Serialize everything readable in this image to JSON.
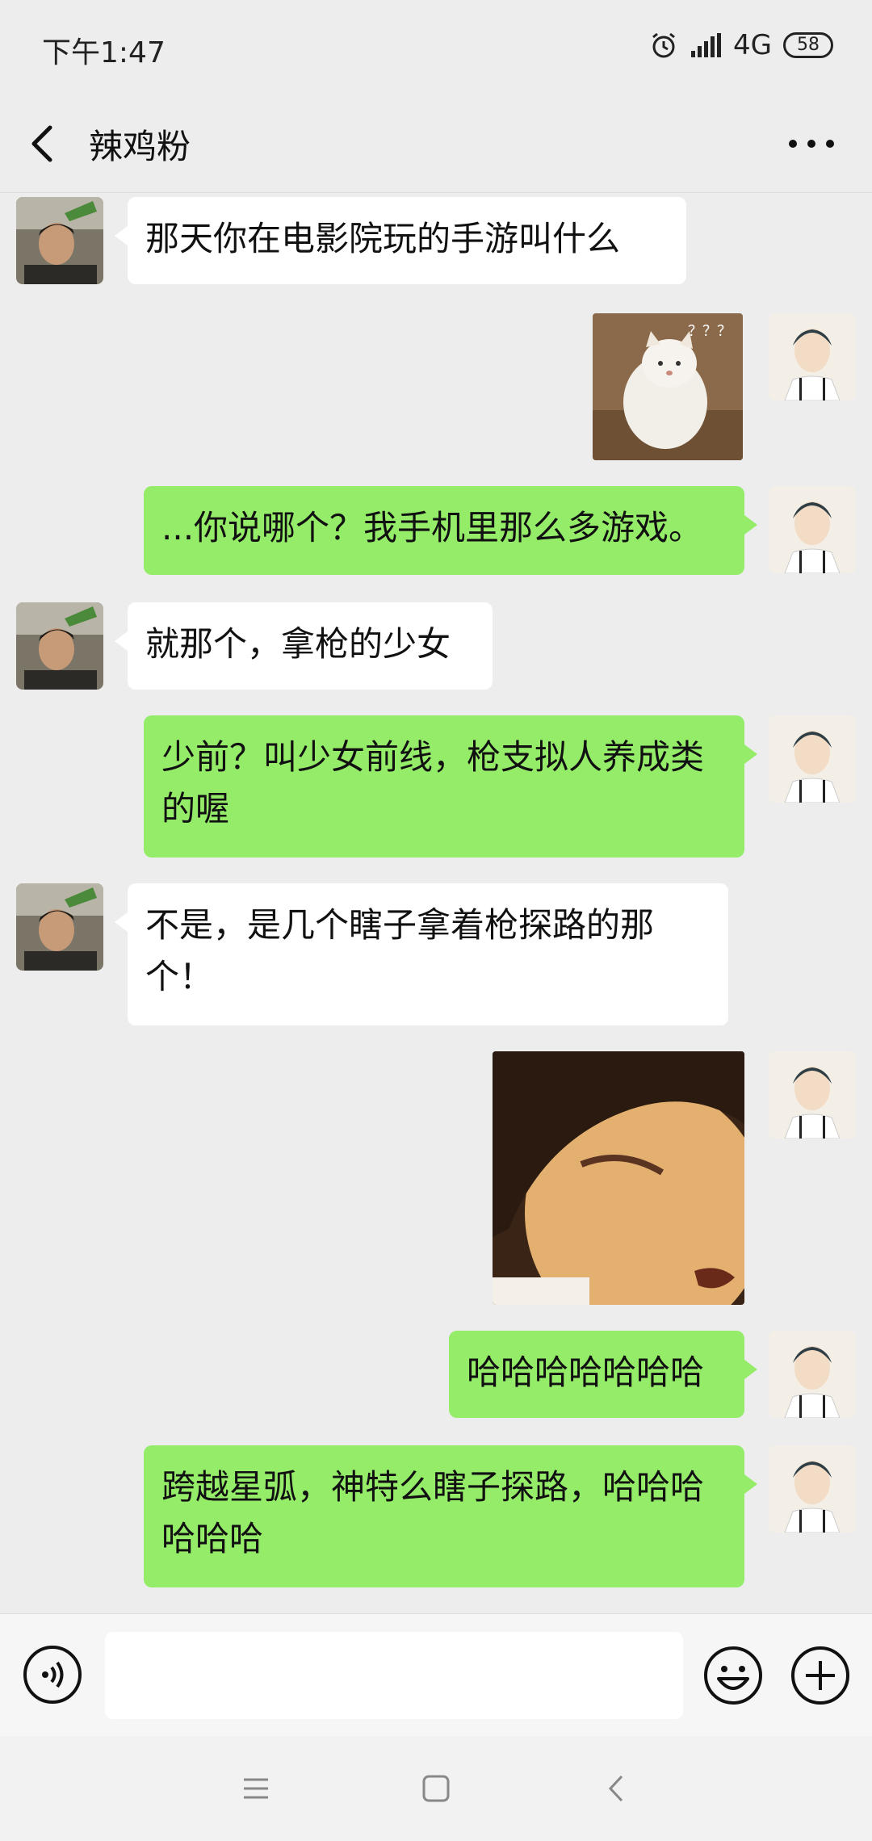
{
  "status": {
    "time": "下午1:47",
    "network": "4G",
    "battery": "58"
  },
  "header": {
    "title": "辣鸡粉"
  },
  "messages": [
    {
      "side": "left",
      "type": "text",
      "text": "那天你在电影院玩的手游叫什么"
    },
    {
      "side": "right",
      "type": "sticker",
      "text": "？？？"
    },
    {
      "side": "right",
      "type": "text",
      "text": "...你说哪个？我手机里那么多游戏。"
    },
    {
      "side": "left",
      "type": "text",
      "text": "就那个，拿枪的少女"
    },
    {
      "side": "right",
      "type": "text",
      "text": "少前？叫少女前线，枪支拟人养成类的喔"
    },
    {
      "side": "left",
      "type": "text",
      "text": "不是，是几个瞎子拿着枪探路的那个！"
    },
    {
      "side": "right",
      "type": "sticker",
      "text": ""
    },
    {
      "side": "right",
      "type": "text",
      "text": "哈哈哈哈哈哈哈"
    },
    {
      "side": "right",
      "type": "text",
      "text": "跨越星弧，神特么瞎子探路，哈哈哈哈哈哈"
    }
  ],
  "input": {
    "placeholder": ""
  },
  "colors": {
    "bubble_green": "#95ec69",
    "bubble_white": "#ffffff",
    "background": "#ededed"
  },
  "icons": [
    "back-arrow-icon",
    "more-icon",
    "voice-icon",
    "emoji-icon",
    "plus-icon",
    "menu-icon",
    "home-icon",
    "nav-back-icon",
    "alarm-icon",
    "signal-icon"
  ]
}
